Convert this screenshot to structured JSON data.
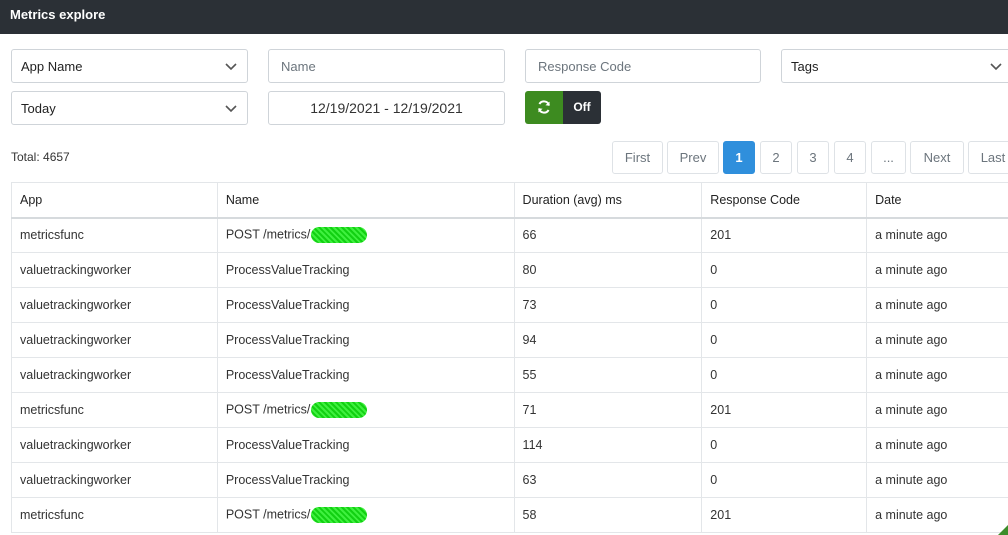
{
  "header": {
    "title": "Metrics explore"
  },
  "filters": {
    "app_name": "App Name",
    "name_placeholder": "Name",
    "response_code_placeholder": "Response Code",
    "tags": "Tags",
    "date_range_select": "Today",
    "date_range_value": "12/19/2021 - 12/19/2021",
    "auto_refresh_label": "Off"
  },
  "summary": {
    "total": "Total: 4657"
  },
  "pagination": {
    "first": "First",
    "prev": "Prev",
    "pages": [
      "1",
      "2",
      "3",
      "4"
    ],
    "ellipsis": "...",
    "next": "Next",
    "last": "Last",
    "active_page": "1"
  },
  "table": {
    "columns": [
      "App",
      "Name",
      "Duration (avg) ms",
      "Response Code",
      "Date"
    ],
    "rows": [
      {
        "app": "metricsfunc",
        "name": "POST /metrics/",
        "redacted": true,
        "duration": "66",
        "code": "201",
        "date": "a minute ago"
      },
      {
        "app": "valuetrackingworker",
        "name": "ProcessValueTracking",
        "redacted": false,
        "duration": "80",
        "code": "0",
        "date": "a minute ago"
      },
      {
        "app": "valuetrackingworker",
        "name": "ProcessValueTracking",
        "redacted": false,
        "duration": "73",
        "code": "0",
        "date": "a minute ago"
      },
      {
        "app": "valuetrackingworker",
        "name": "ProcessValueTracking",
        "redacted": false,
        "duration": "94",
        "code": "0",
        "date": "a minute ago"
      },
      {
        "app": "valuetrackingworker",
        "name": "ProcessValueTracking",
        "redacted": false,
        "duration": "55",
        "code": "0",
        "date": "a minute ago"
      },
      {
        "app": "metricsfunc",
        "name": "POST /metrics/",
        "redacted": true,
        "duration": "71",
        "code": "201",
        "date": "a minute ago"
      },
      {
        "app": "valuetrackingworker",
        "name": "ProcessValueTracking",
        "redacted": false,
        "duration": "114",
        "code": "0",
        "date": "a minute ago"
      },
      {
        "app": "valuetrackingworker",
        "name": "ProcessValueTracking",
        "redacted": false,
        "duration": "63",
        "code": "0",
        "date": "a minute ago"
      },
      {
        "app": "metricsfunc",
        "name": "POST /metrics/",
        "redacted": true,
        "duration": "58",
        "code": "201",
        "date": "a minute ago"
      }
    ]
  },
  "colors": {
    "header_bg": "#2b3036",
    "accent_blue": "#2f8fdc",
    "toggle_green": "#3d8b20",
    "redaction_green": "#12d012"
  },
  "icons": {
    "refresh": "refresh-icon",
    "dropdown": "chevron-down-icon"
  }
}
